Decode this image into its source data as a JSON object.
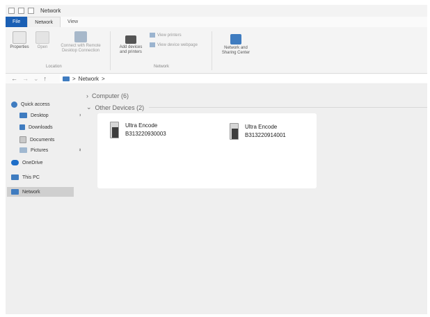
{
  "window": {
    "title": "Network"
  },
  "tabs": [
    {
      "label": "File"
    },
    {
      "label": "Network"
    },
    {
      "label": "View"
    }
  ],
  "ribbon": {
    "properties": "Properties",
    "open": "Open",
    "connect_line1": "Connect with Remote",
    "connect_line2": "Desktop Connection",
    "location_group": "Location",
    "add_devices_line1": "Add devices",
    "add_devices_line2": "and printers",
    "view_printers": "View printers",
    "view_device_webpage": "View device webpage",
    "network_group": "Network",
    "nsc_line1": "Network and",
    "nsc_line2": "Sharing Center"
  },
  "address": {
    "path": "Network",
    "separator": ">"
  },
  "sidebar": {
    "quick_access": "Quick access",
    "desktop": "Desktop",
    "downloads": "Downloads",
    "documents": "Documents",
    "pictures": "Pictures",
    "onedrive": "OneDrive",
    "this_pc": "This PC",
    "network": "Network"
  },
  "content": {
    "computer_header": "Computer (6)",
    "other_devices_header": "Other Devices (2)",
    "devices": [
      {
        "name": "Ultra Encode",
        "serial": "B313220930003"
      },
      {
        "name": "Ultra Encode",
        "serial": "B313220914001"
      }
    ]
  },
  "colors": {
    "file_tab": "#1a5fb4",
    "accent": "#3f7cc0"
  }
}
